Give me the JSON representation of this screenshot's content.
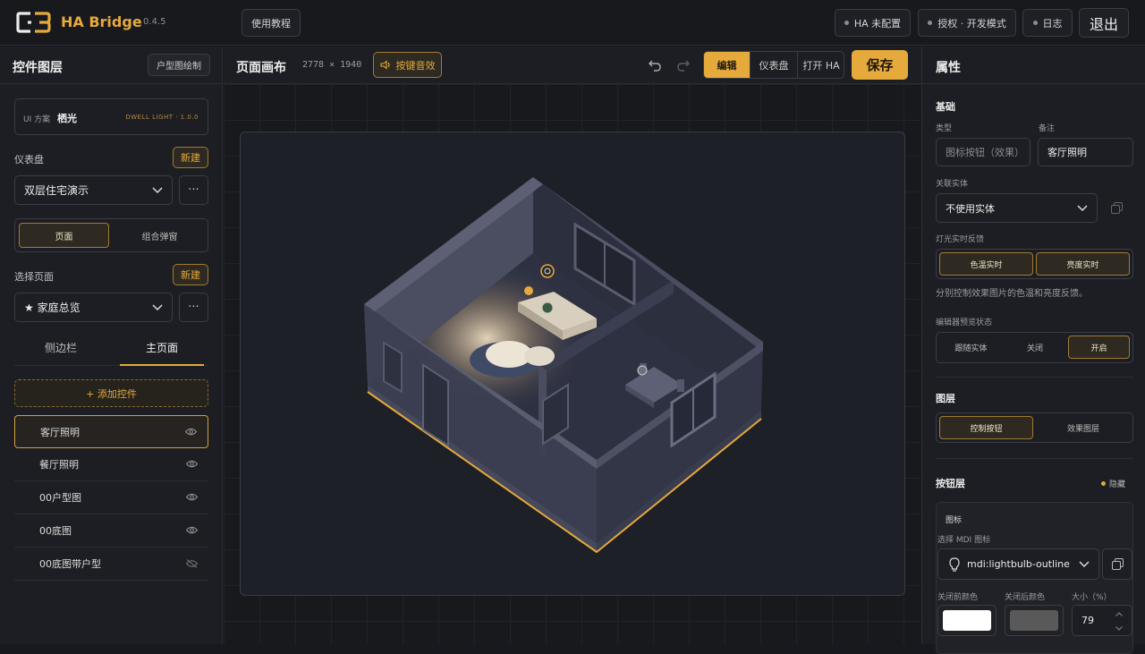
{
  "app": {
    "name": "HA Bridge",
    "version": "0.4.5",
    "tutorial": "使用教程"
  },
  "status": {
    "ha": "HA 未配置",
    "license": "授权 · 开发模式",
    "log": "日志",
    "exit": "退出"
  },
  "left": {
    "title": "控件图层",
    "floorplan_btn": "户型图绘制",
    "scheme_label": "UI 方案",
    "scheme_name": "栖光",
    "scheme_tag": "DWELL LIGHT · 1.0.0",
    "dashboard_label": "仪表盘",
    "new": "新建",
    "dashboard_value": "双层住宅演示",
    "more": "···",
    "mode_tabs": [
      "页面",
      "组合弹窗"
    ],
    "page_label": "选择页面",
    "page_value": "★ 家庭总览",
    "area_tabs": [
      "侧边栏",
      "主页面"
    ],
    "add_widget": "+ 添加控件",
    "layers": [
      "客厅照明",
      "餐厅照明",
      "00户型图",
      "00底图",
      "00底图带户型"
    ]
  },
  "canvas": {
    "title": "页面画布",
    "size": "2778 × 1940",
    "sound": "按键音效",
    "modes": [
      "编辑",
      "仪表盘",
      "打开 HA"
    ],
    "save": "保存"
  },
  "props": {
    "title": "属性",
    "basic": "基础",
    "type_label": "类型",
    "type_placeholder": "图标按钮（效果）",
    "note_label": "备注",
    "note_value": "客厅照明",
    "entity_label": "关联实体",
    "entity_value": "不使用实体",
    "feedback_label": "灯光实时反馈",
    "feedback_opts": [
      "色温实时",
      "亮度实时"
    ],
    "feedback_hint": "分别控制效果图片的色温和亮度反馈。",
    "preview_label": "编辑器预览状态",
    "preview_opts": [
      "跟随实体",
      "关闭",
      "开启"
    ],
    "layer_section": "图层",
    "layer_opts": [
      "控制按钮",
      "效果图层"
    ],
    "button_layer": "按钮层",
    "hide": "隐藏",
    "icon_section": "图标",
    "mdi_label": "选择 MDI 图标",
    "mdi_value": "mdi:lightbulb-outline",
    "color_off_label": "关闭前颜色",
    "color_on_label": "关闭后颜色",
    "size_label": "大小（%）",
    "size_value": "79"
  },
  "colors": {
    "accent": "#e6a93c",
    "bg": "#17191e",
    "panel": "#1c1e23",
    "swatch_off": "#ffffff",
    "swatch_on": "#595959"
  }
}
